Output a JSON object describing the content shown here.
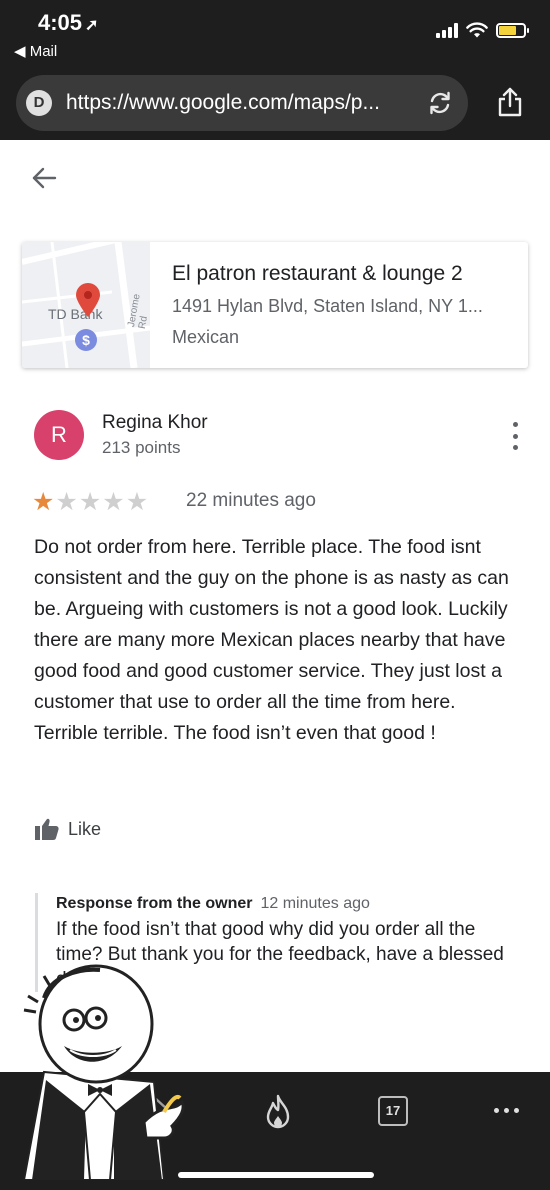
{
  "status_bar": {
    "time": "4:05",
    "location_arrow": "➚",
    "back_app": "◀ Mail",
    "battery_color": "#f5d33a"
  },
  "browser": {
    "site_badge": "D",
    "url": "https://www.google.com/maps/p..."
  },
  "place": {
    "name": "El patron restaurant & lounge 2",
    "address": "1491 Hylan Blvd, Staten Island, NY 1...",
    "category": "Mexican",
    "map_poi_label": "TD Bank",
    "map_road_label": "Jerome Rd",
    "pin_color": "#e04a3c",
    "bank_marker_color": "#7b8be0"
  },
  "review": {
    "avatar_letter": "R",
    "avatar_color": "#d8416b",
    "reviewer_name": "Regina Khor",
    "reviewer_points": "213 points",
    "rating": 1,
    "rating_max": 5,
    "time_ago": "22 minutes ago",
    "text": "Do not order from here. Terrible place. The food isnt consistent and the guy on the phone is as nasty as can be. Argueing with customers is not a good look. Luckily there are many more Mexican places nearby that have good food and good customer service. They just lost a customer that use to order all the time from here. Terrible terrible. The food isn’t even that good !",
    "like_label": "Like",
    "star_color": "#e8883a"
  },
  "owner_response": {
    "title": "Response from the owner",
    "time_ago": "12 minutes ago",
    "text": "If the food isn’t that good why did you order all the time? But thank you for the feedback, have a blessed day :)"
  },
  "bottom_bar": {
    "calendar_number": "17"
  }
}
